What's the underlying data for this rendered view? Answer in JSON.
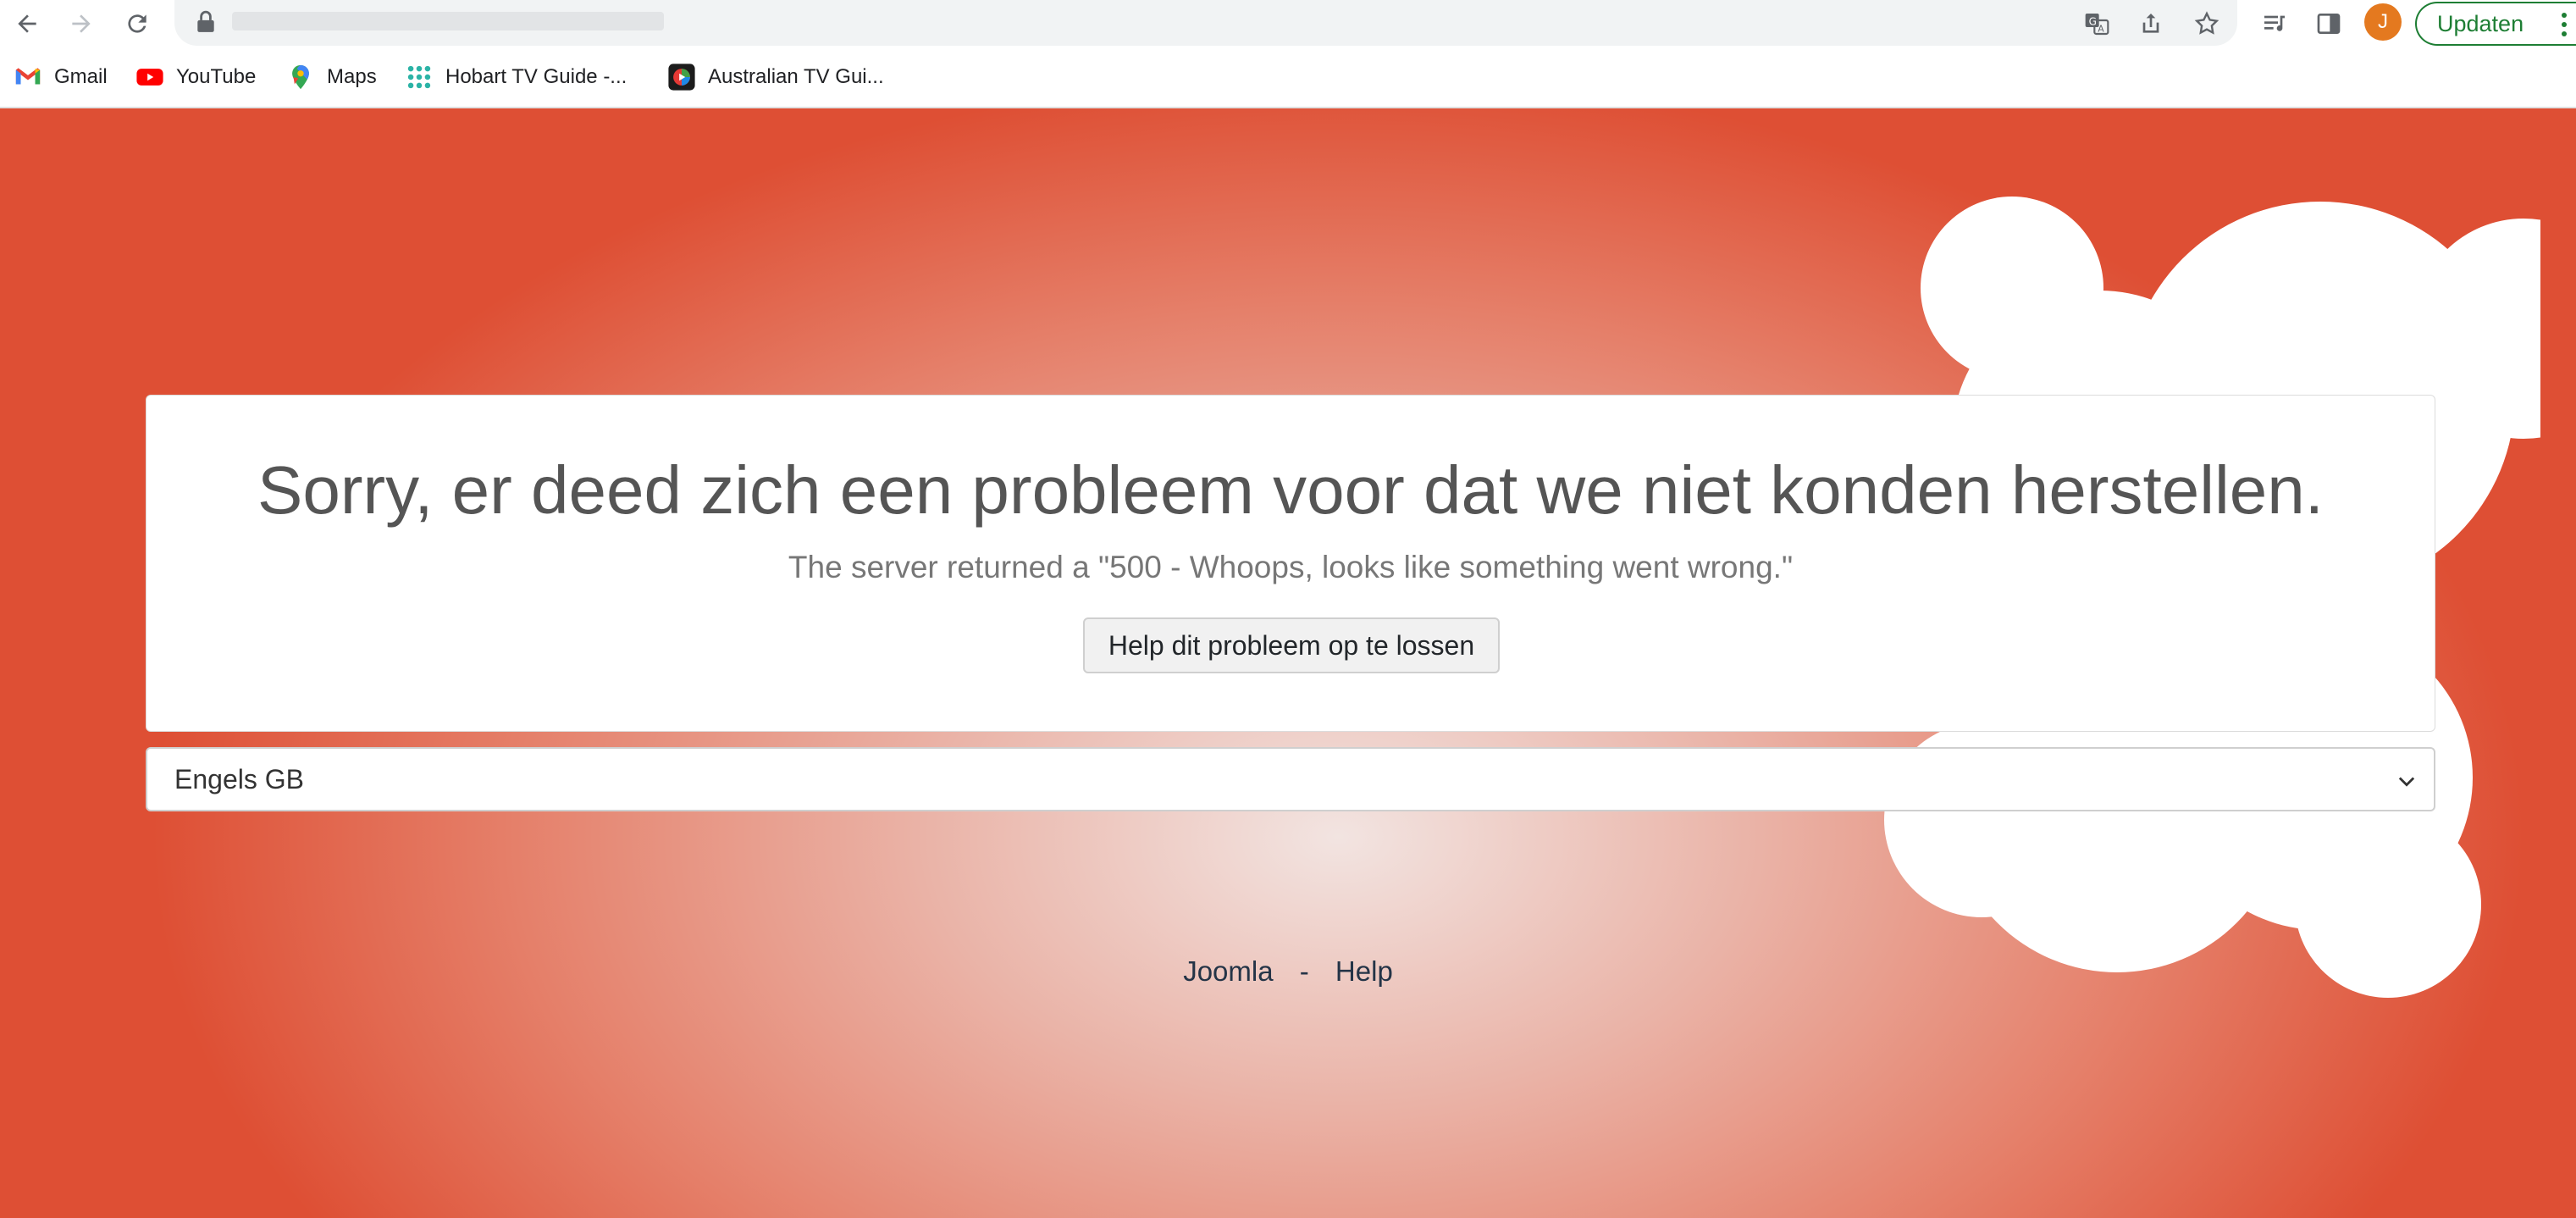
{
  "browser": {
    "bookmarks": [
      {
        "label": "Gmail",
        "icon": "gmail-icon"
      },
      {
        "label": "YouTube",
        "icon": "youtube-icon"
      },
      {
        "label": "Maps",
        "icon": "maps-icon"
      },
      {
        "label": "Hobart TV Guide -...",
        "icon": "apps-grid-icon"
      },
      {
        "label": "Australian TV Gui...",
        "icon": "tv-guide-icon"
      }
    ],
    "avatar_initial": "J",
    "update_label": "Updaten",
    "colors": {
      "update": "#1e7e34",
      "avatar": "#e4791f"
    }
  },
  "error": {
    "title": "Sorry, er deed zich een probleem voor dat we niet konden herstellen.",
    "subtitle": "The server returned a \"500 - Whoops, looks like something went wrong.\"",
    "help_button": "Help dit probleem op te lossen"
  },
  "language": {
    "selected": "Engels GB"
  },
  "footer": {
    "joomla": "Joomla",
    "separator": "-",
    "help": "Help"
  },
  "theme": {
    "background_edge": "#de4f34",
    "background_center": "#f2e4e1"
  }
}
